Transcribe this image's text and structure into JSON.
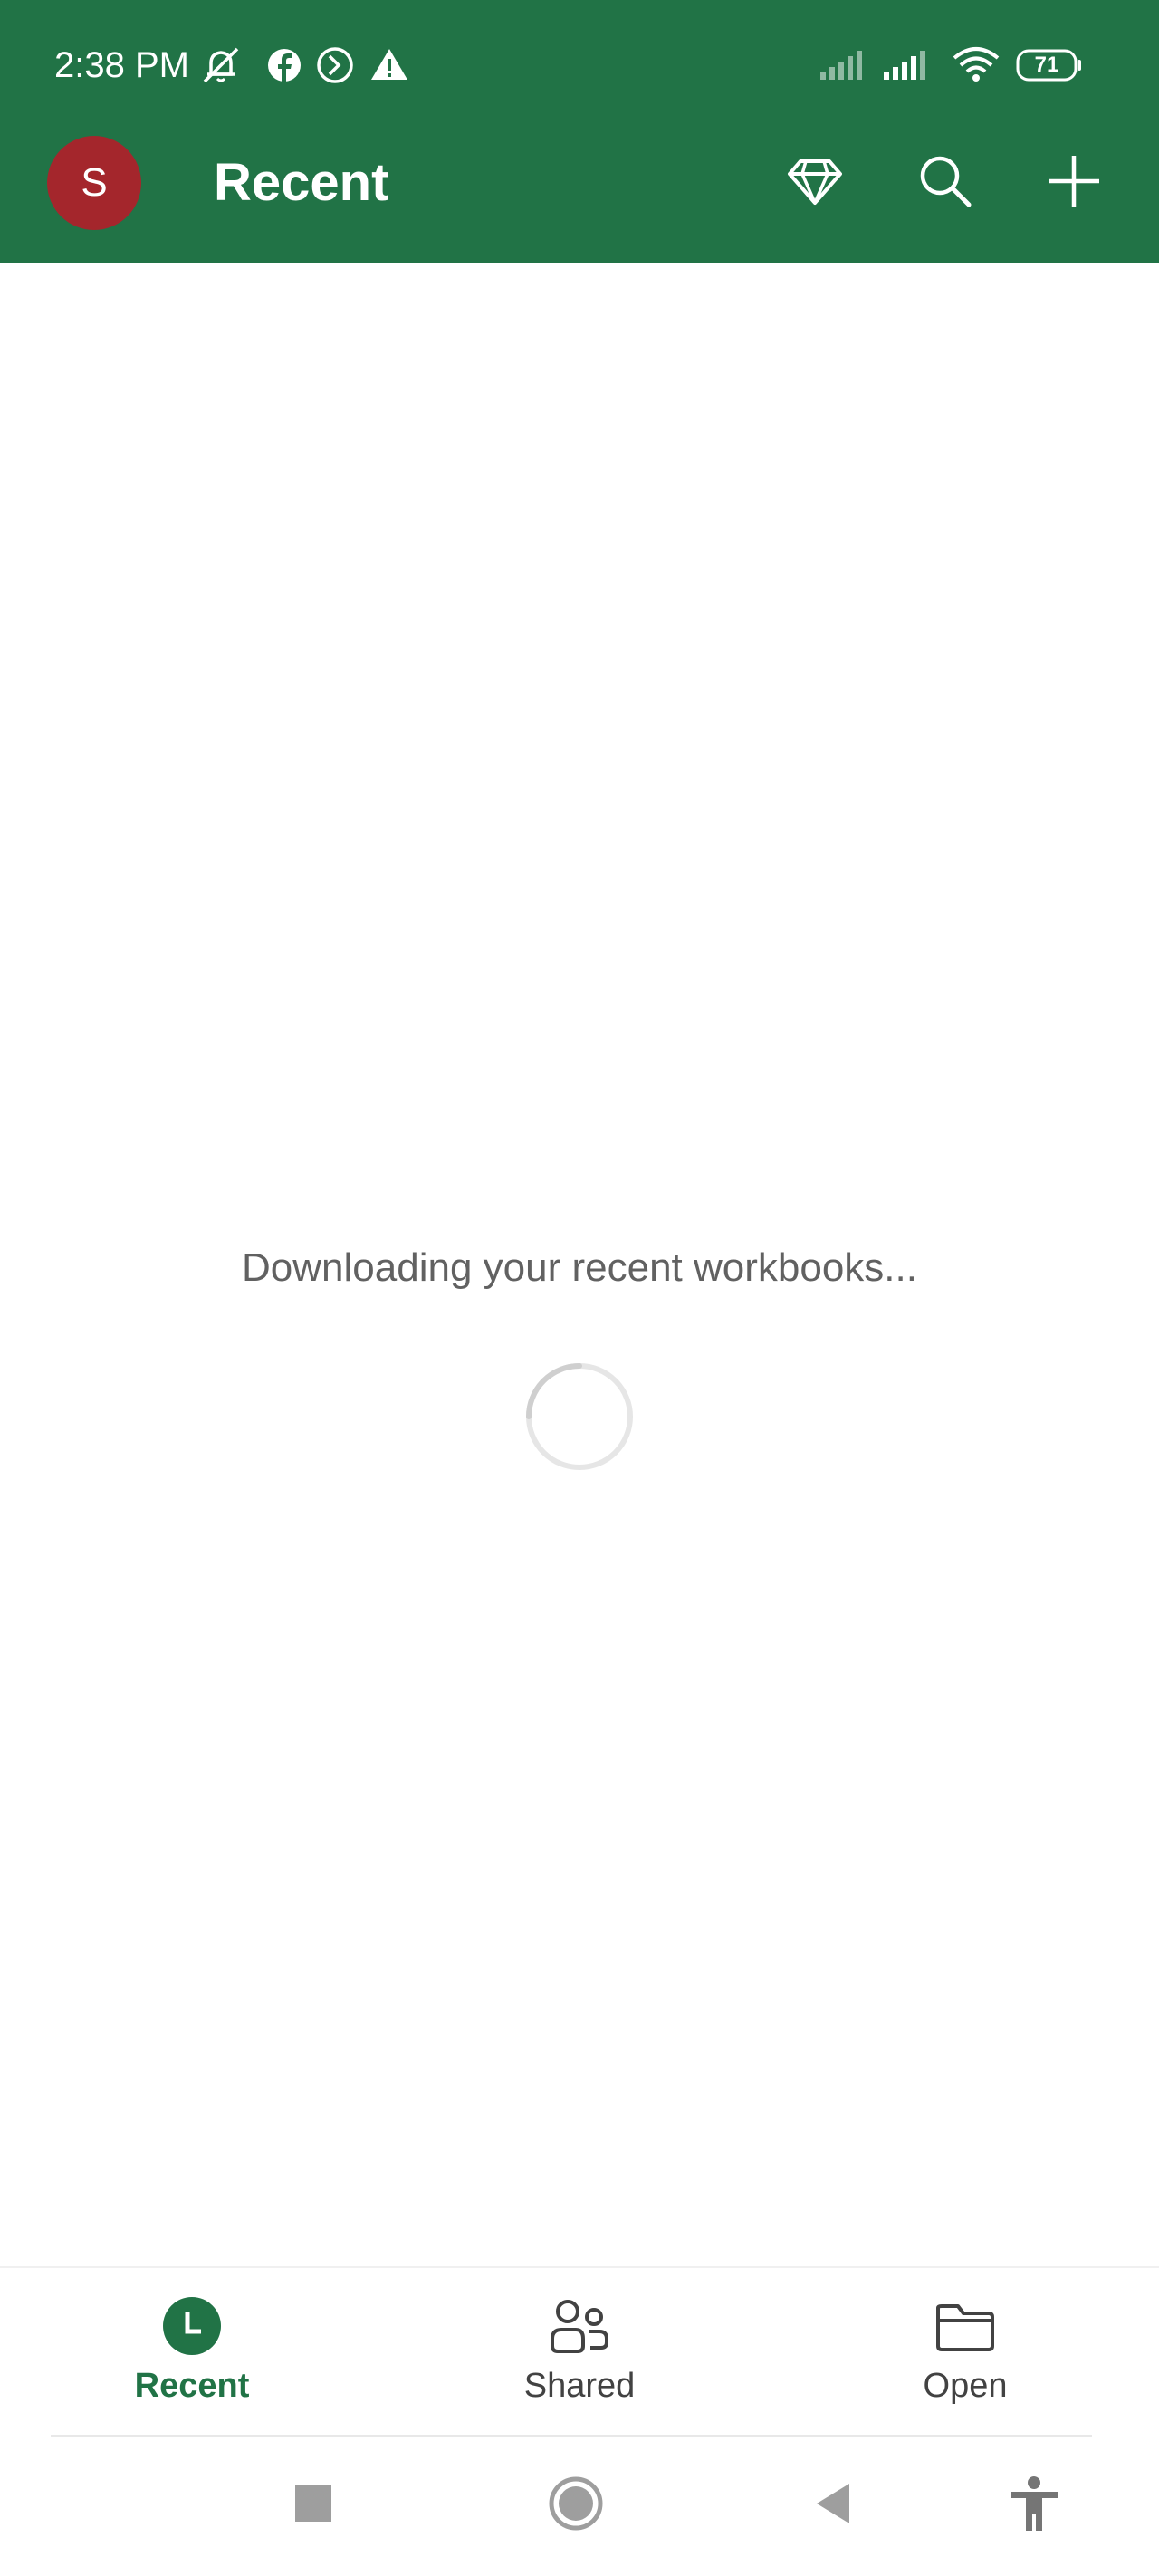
{
  "status_bar": {
    "time": "2:38 PM",
    "battery_level": "71",
    "icons": [
      "notifications-off-icon",
      "facebook-icon",
      "app-icon",
      "warning-icon",
      "signal-icon",
      "signal-icon",
      "wifi-icon",
      "battery-icon"
    ]
  },
  "app_bar": {
    "avatar_initial": "S",
    "title": "Recent",
    "actions": [
      "premium-diamond-icon",
      "search-icon",
      "add-icon"
    ]
  },
  "main": {
    "loading_message": "Downloading your recent workbooks..."
  },
  "bottom_nav": {
    "items": [
      {
        "label": "Recent",
        "icon": "clock-icon",
        "active": true
      },
      {
        "label": "Shared",
        "icon": "people-icon",
        "active": false
      },
      {
        "label": "Open",
        "icon": "folder-icon",
        "active": false
      }
    ]
  },
  "system_nav": {
    "buttons": [
      "recents-square-icon",
      "home-circle-icon",
      "back-triangle-icon",
      "accessibility-icon"
    ]
  },
  "colors": {
    "brand_green": "#217346",
    "avatar_red": "#a4262c",
    "text_gray": "#616161"
  }
}
